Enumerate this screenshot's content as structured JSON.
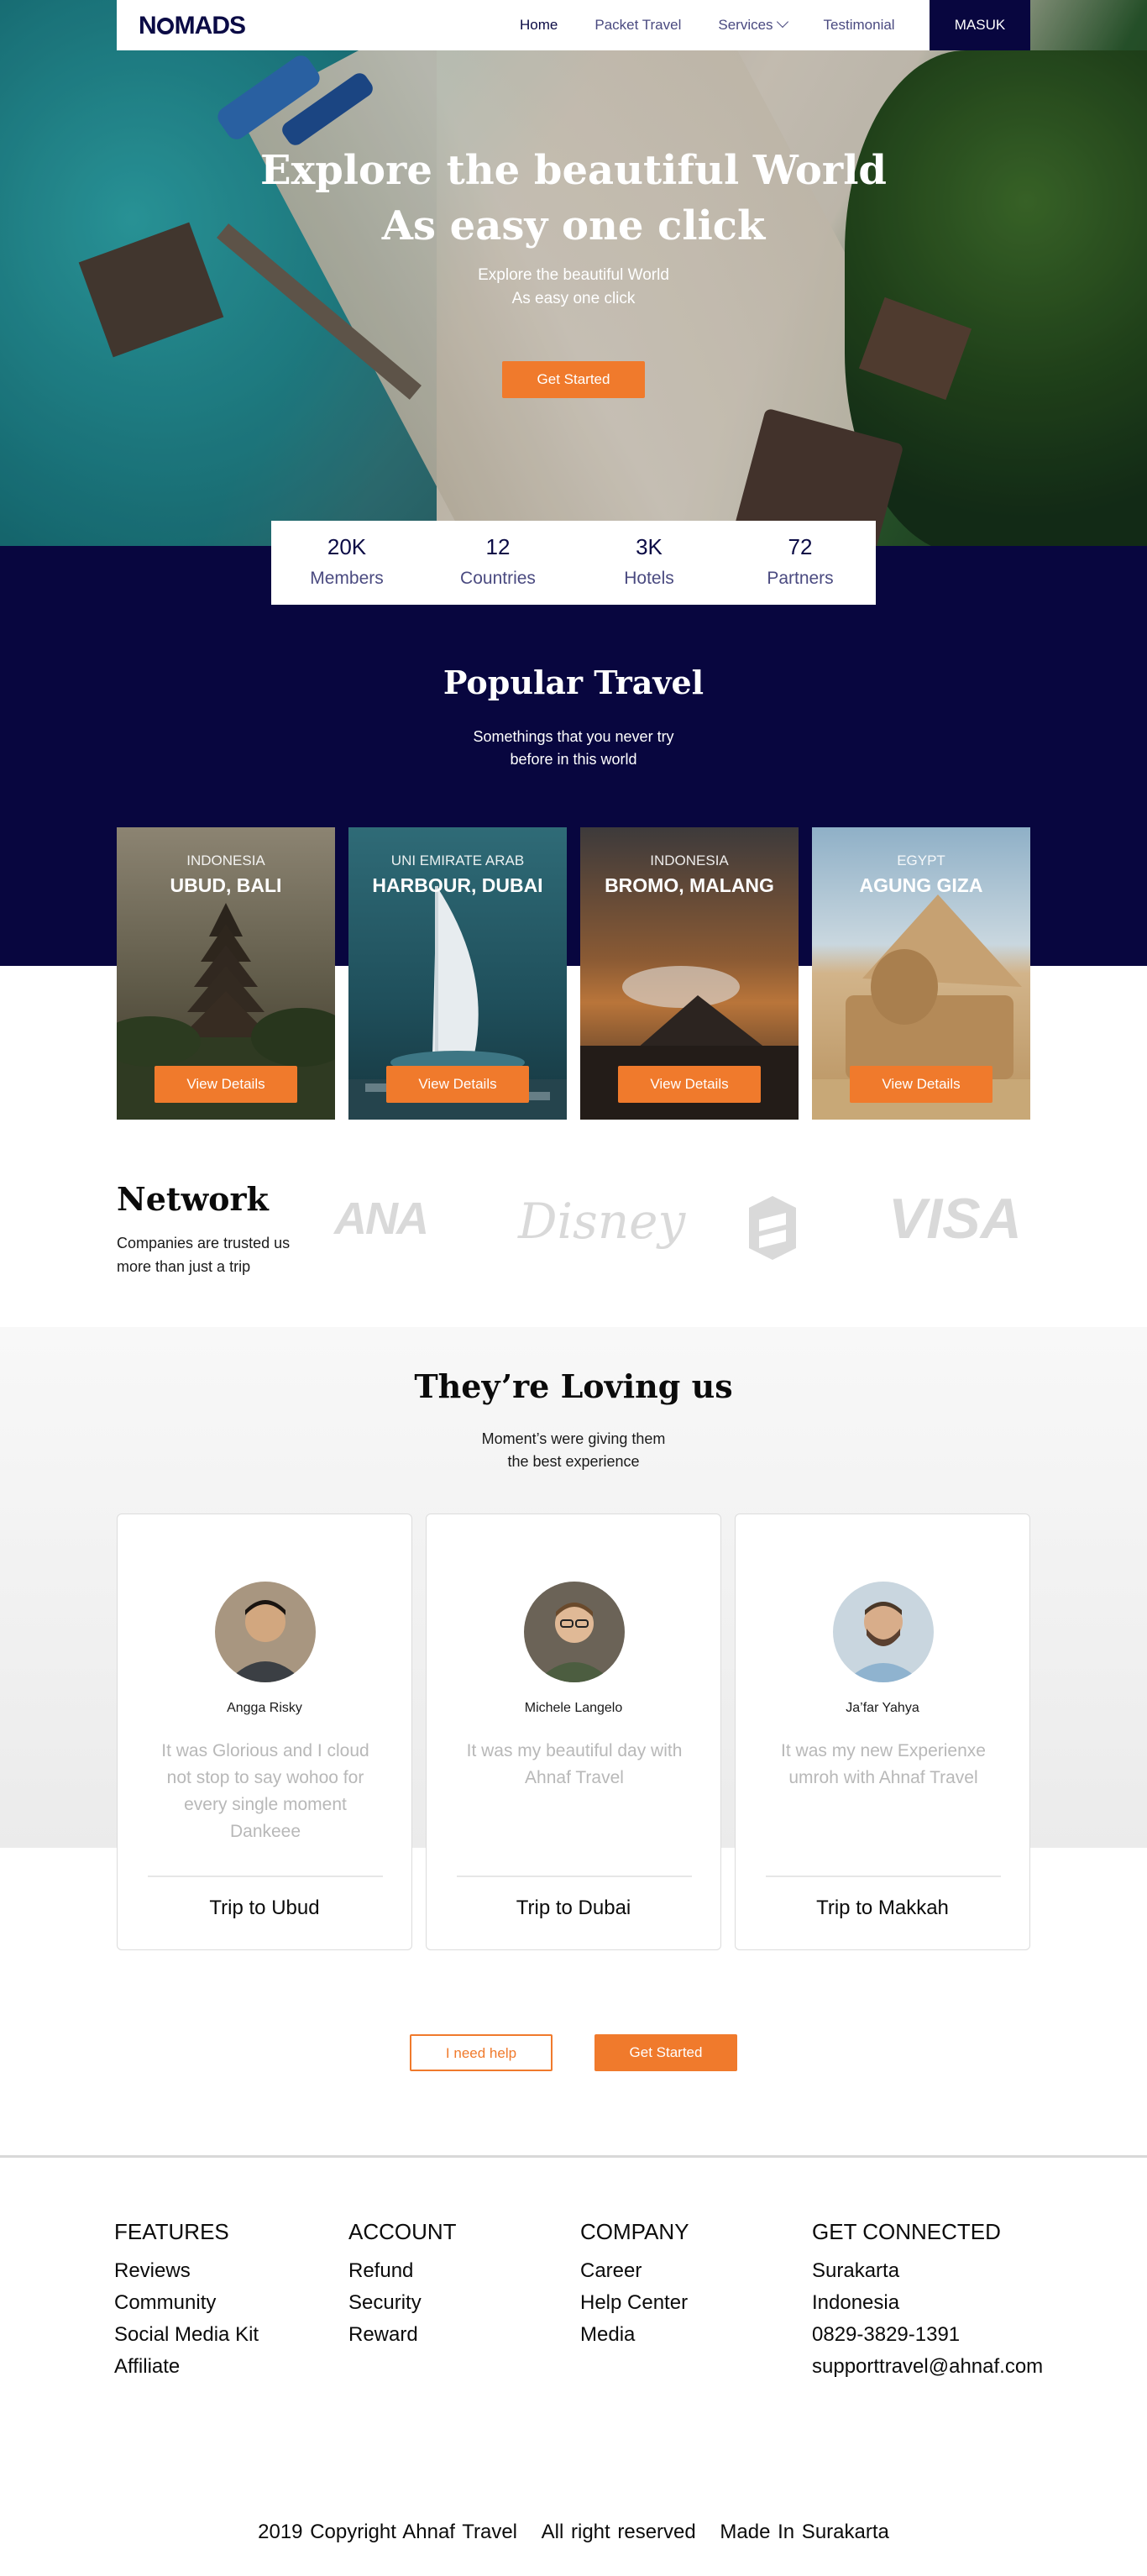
{
  "nav": {
    "logo": "N MADS",
    "links": [
      "Home",
      "Packet Travel",
      "Services",
      "Testimonial"
    ],
    "login": "MASUK"
  },
  "hero": {
    "title_line1": "Explore the beautiful World",
    "title_line2": "As easy one click",
    "sub_line1": "Explore the beautiful World",
    "sub_line2": "As easy one click",
    "cta": "Get Started"
  },
  "stats": [
    {
      "value": "20K",
      "label": "Members"
    },
    {
      "value": "12",
      "label": "Countries"
    },
    {
      "value": "3K",
      "label": "Hotels"
    },
    {
      "value": "72",
      "label": "Partners"
    }
  ],
  "popular": {
    "title": "Popular Travel",
    "sub_line1": "Somethings that you never try",
    "sub_line2": "before in this world",
    "cards": [
      {
        "country": "INDONESIA",
        "name": "UBUD, BALI",
        "button": "View Details"
      },
      {
        "country": "UNI EMIRATE ARAB",
        "name": "HARBOUR, DUBAI",
        "button": "View Details"
      },
      {
        "country": "INDONESIA",
        "name": "BROMO, MALANG",
        "button": "View Details"
      },
      {
        "country": "EGYPT",
        "name": "AGUNG GIZA",
        "button": "View Details"
      }
    ]
  },
  "network": {
    "title": "Network",
    "sub_line1": "Companies are trusted us",
    "sub_line2": "more than just a trip",
    "brands": [
      "ANA",
      "Disney",
      "VISA"
    ]
  },
  "testimonials": {
    "title": "They’re Loving us",
    "sub_line1": "Moment’s were giving them",
    "sub_line2": "the best experience",
    "items": [
      {
        "name": "Angga Risky",
        "quote": "It was Glorious and I cloud not stop to say wohoo for every single moment Dankeee",
        "trip": "Trip to Ubud"
      },
      {
        "name": "Michele Langelo",
        "quote": "It was my beautiful day with Ahnaf Travel",
        "trip": "Trip to Dubai"
      },
      {
        "name": "Ja’far Yahya",
        "quote": "It was my new Experienxe umroh with Ahnaf Travel",
        "trip": "Trip to Makkah"
      }
    ]
  },
  "cta": {
    "help": "I need help",
    "start": "Get Started"
  },
  "footer": {
    "columns": [
      {
        "title": "FEATURES",
        "items": [
          "Reviews",
          "Community",
          "Social Media Kit",
          "Affiliate"
        ]
      },
      {
        "title": "ACCOUNT",
        "items": [
          "Refund",
          "Security",
          "Reward"
        ]
      },
      {
        "title": "COMPANY",
        "items": [
          "Career",
          "Help Center",
          "Media"
        ]
      },
      {
        "title": "GET CONNECTED",
        "items": [
          "Surakarta",
          "Indonesia",
          "0829-3829-1391",
          "supporttravel@ahnaf.com"
        ]
      }
    ],
    "copyright": "2019 Copyright Ahnaf Travel",
    "rights": "All right reserved",
    "made_in": "Made In Surakarta"
  },
  "colors": {
    "navy": "#08063f",
    "accent": "#f07a2c"
  }
}
